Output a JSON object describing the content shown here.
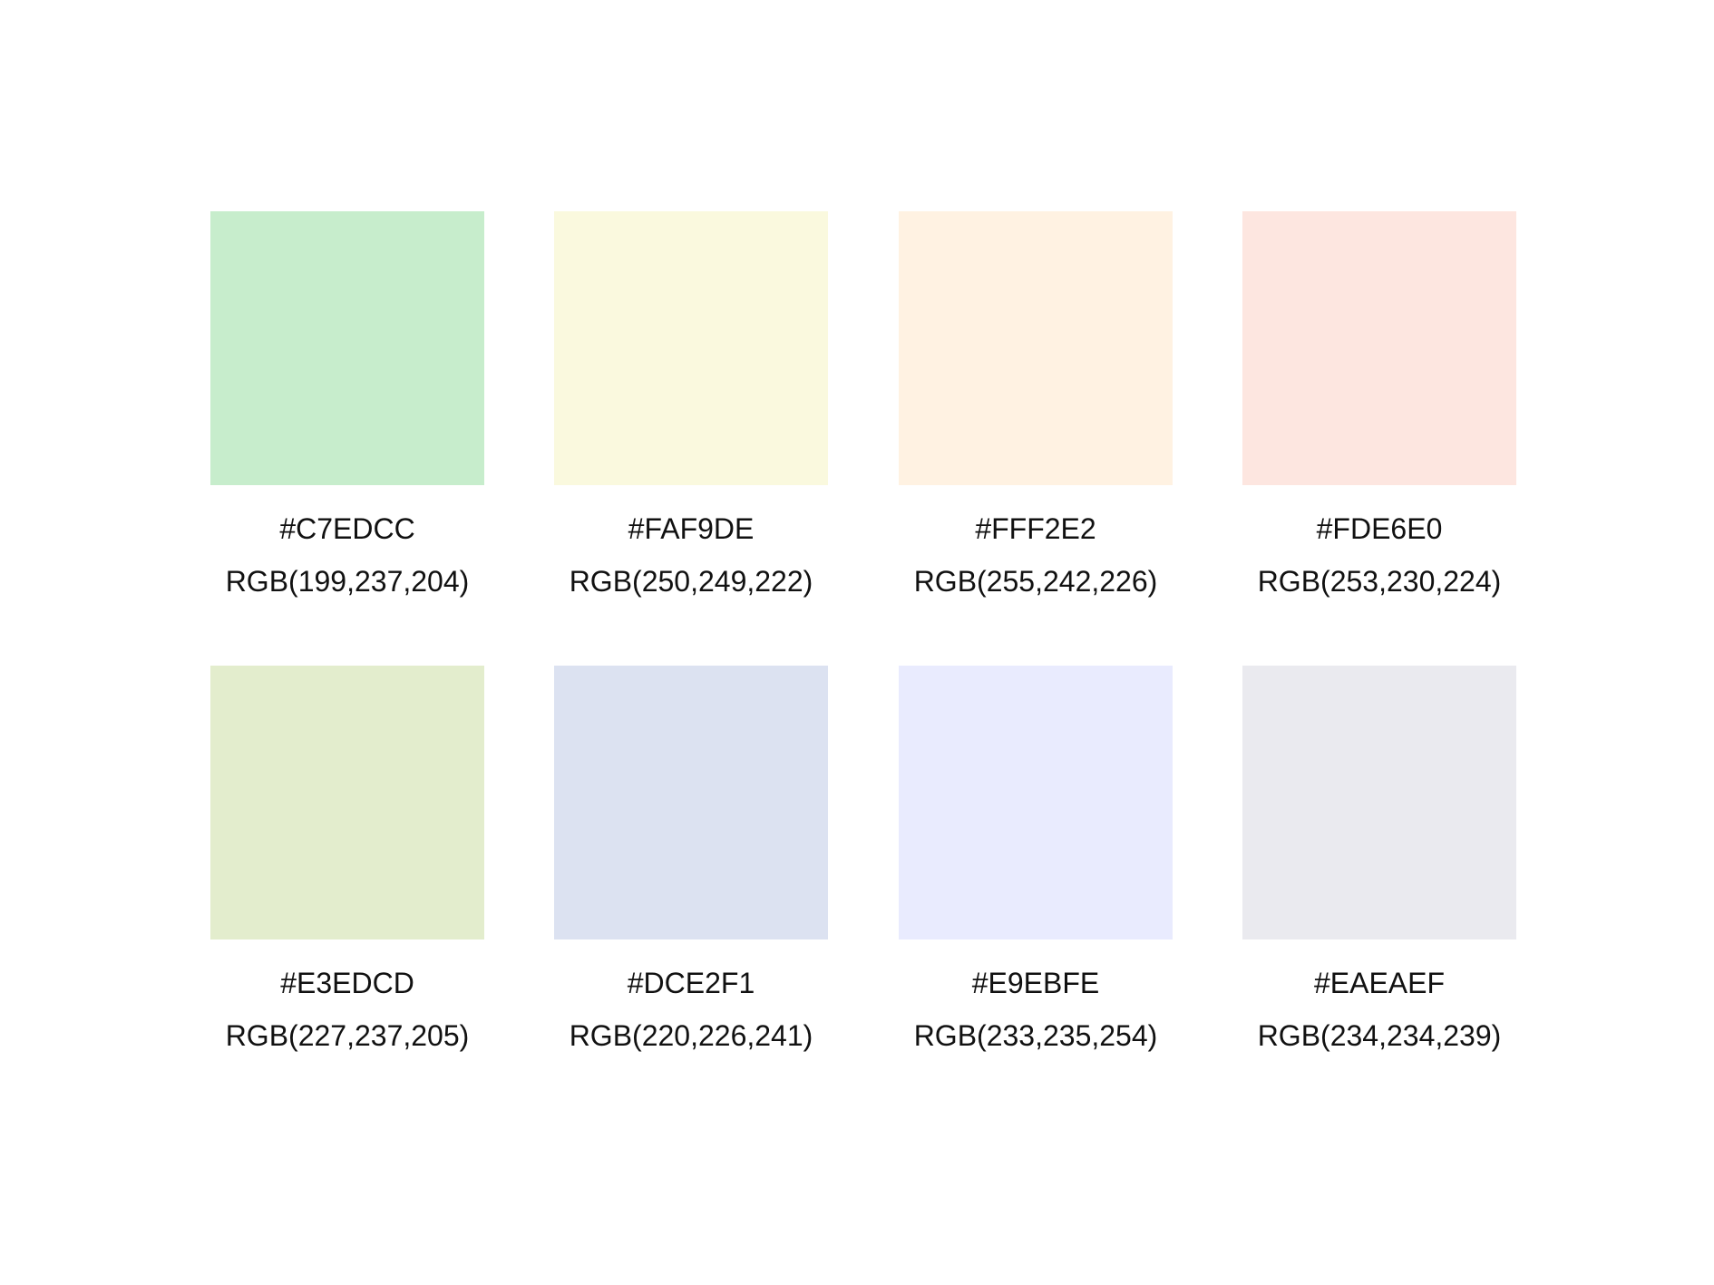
{
  "swatches": [
    {
      "hex": "#C7EDCC",
      "rgb": "RGB(199,237,204)",
      "color": "#C7EDCC"
    },
    {
      "hex": "#FAF9DE",
      "rgb": "RGB(250,249,222)",
      "color": "#FAF9DE"
    },
    {
      "hex": "#FFF2E2",
      "rgb": "RGB(255,242,226)",
      "color": "#FFF2E2"
    },
    {
      "hex": "#FDE6E0",
      "rgb": "RGB(253,230,224)",
      "color": "#FDE6E0"
    },
    {
      "hex": "#E3EDCD",
      "rgb": "RGB(227,237,205)",
      "color": "#E3EDCD"
    },
    {
      "hex": "#DCE2F1",
      "rgb": "RGB(220,226,241)",
      "color": "#DCE2F1"
    },
    {
      "hex": "#E9EBFE",
      "rgb": "RGB(233,235,254)",
      "color": "#E9EBFE"
    },
    {
      "hex": "#EAEAEF",
      "rgb": "RGB(234,234,239)",
      "color": "#EAEAEF"
    }
  ]
}
